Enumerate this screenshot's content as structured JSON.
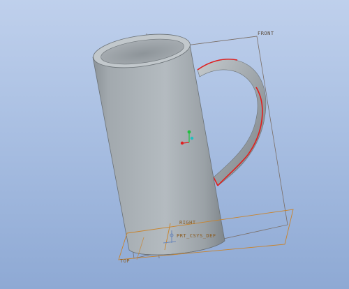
{
  "app": {
    "view": "3D model viewport",
    "model": "mug"
  },
  "datum_labels": {
    "front": "FRONT",
    "right": "RIGHT",
    "csys": "PRT_CSYS_DEF",
    "top": "TOP"
  },
  "colors": {
    "background_top": "#bfd0ec",
    "background_bottom": "#8ea9d4",
    "model_fill": "#a9b0b5",
    "datum_plane": "#7a6e66",
    "datum_plane_highlight": "#c9832a",
    "edge_highlight": "#e01e1e",
    "csys_x": "#e02020",
    "csys_y": "#20c040",
    "csys_z": "#20c0c0"
  },
  "icons": {
    "coordinate_system": "csys-triad-icon",
    "default_csys": "default-csys-icon"
  }
}
